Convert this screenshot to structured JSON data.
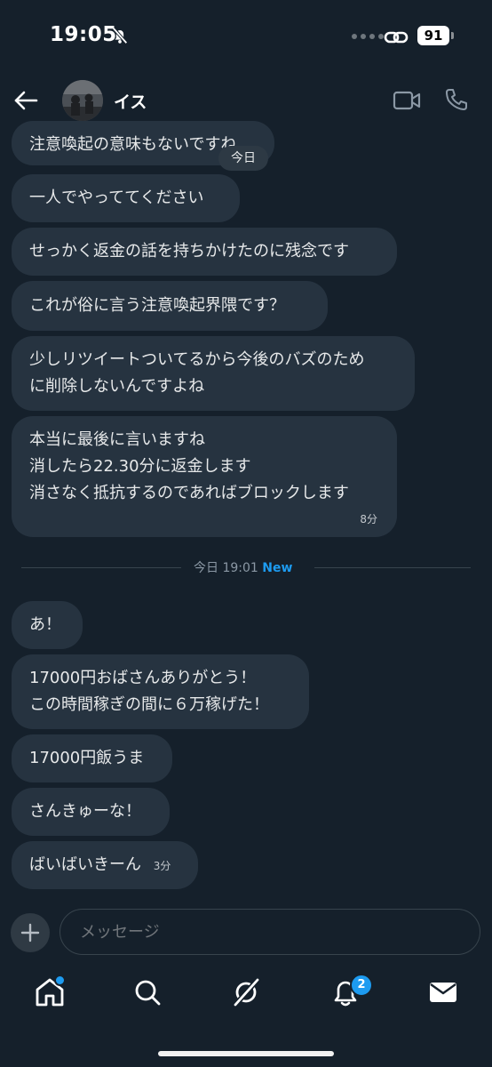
{
  "status": {
    "time": "19:05",
    "battery": "91"
  },
  "header": {
    "contact_name": "イス"
  },
  "messages": [
    {
      "lines": [
        "注意喚起の意味もないですね"
      ]
    },
    {
      "lines": [
        "一人でやっててください"
      ]
    },
    {
      "lines": [
        "せっかく返金の話を持ちかけたのに残念です"
      ]
    },
    {
      "lines": [
        "これが俗に言う注意喚起界隈です？"
      ]
    },
    {
      "lines": [
        "少しリツイートついてるから今後のバズのため",
        "に削除しないんですよね"
      ]
    },
    {
      "lines": [
        "本当に最後に言いますね",
        "消したら22.30分に返金します",
        "消さなく抵抗するのであればブロックします"
      ],
      "time": "8分"
    },
    {
      "lines": [
        "あ！"
      ]
    },
    {
      "lines": [
        "17000円おばさんありがとう！",
        "この時間稼ぎの間に６万稼げた！"
      ]
    },
    {
      "lines": [
        "17000円飯うま"
      ]
    },
    {
      "lines": [
        "さんきゅーな！"
      ]
    },
    {
      "lines": [
        "ばいばいきーん"
      ],
      "time": "3分"
    }
  ],
  "today_pill": "今日",
  "divider": {
    "label": "今日 19:01",
    "new_label": "New"
  },
  "composer": {
    "placeholder": "メッセージ"
  },
  "tabbar": {
    "notifications_badge": "2"
  }
}
